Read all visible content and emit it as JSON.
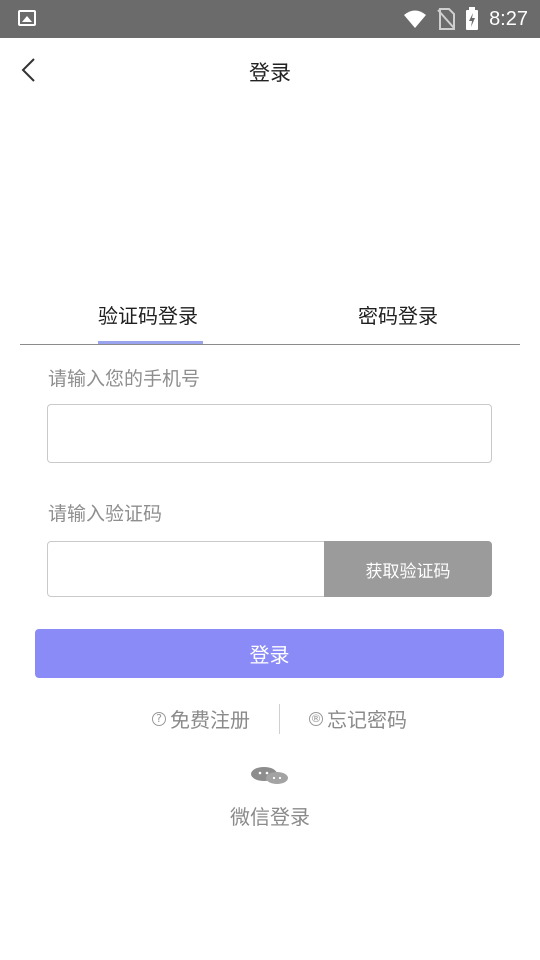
{
  "status_bar": {
    "time": "8:27",
    "icons": [
      "image-icon",
      "wifi-icon",
      "no-sim-icon",
      "battery-charging-icon"
    ]
  },
  "header": {
    "title": "登录",
    "back_icon": "chevron-left-icon"
  },
  "tabs": {
    "items": [
      {
        "label": "验证码登录",
        "active": true
      },
      {
        "label": "密码登录",
        "active": false
      }
    ]
  },
  "form": {
    "phone_label": "请输入您的手机号",
    "phone_value": "",
    "code_label": "请输入验证码",
    "code_value": "",
    "get_code_button": "获取验证码",
    "login_button": "登录"
  },
  "links": {
    "register": {
      "icon": "?",
      "label": "免费注册"
    },
    "forgot": {
      "icon": "®",
      "label": "忘记密码"
    }
  },
  "wechat": {
    "icon": "wechat-icon",
    "label": "微信登录"
  },
  "colors": {
    "primary": "#8b8bf7",
    "tab_indicator": "#9aa4ee",
    "status_bar": "#6b6b6b",
    "disabled_button": "#9b9b9b"
  }
}
